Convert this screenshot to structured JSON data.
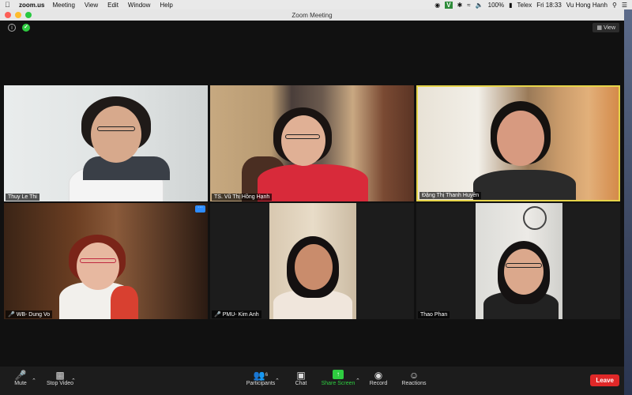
{
  "menubar": {
    "app_name": "zoom.us",
    "items": [
      "Meeting",
      "View",
      "Edit",
      "Window",
      "Help"
    ],
    "battery": "100%",
    "input_source": "Telex",
    "clock": "Fri 18:33",
    "user": "Vu Hong Hanh"
  },
  "window": {
    "title": "Zoom Meeting",
    "view_label": "View"
  },
  "participants": [
    {
      "name": "Thuy Le Thi",
      "muted": false,
      "active": false
    },
    {
      "name": "TS. Vũ Thị Hồng Hạnh",
      "muted": false,
      "active": false
    },
    {
      "name": "Đặng Thị Thanh Huyền",
      "muted": false,
      "active": true
    },
    {
      "name": "WB- Dung Vo",
      "muted": true,
      "active": false
    },
    {
      "name": "PMU- Kim Anh",
      "muted": true,
      "active": false
    },
    {
      "name": "Thao Phan",
      "muted": false,
      "active": false
    }
  ],
  "toolbar": {
    "mute_label": "Mute",
    "stop_video_label": "Stop Video",
    "participants_label": "Participants",
    "participants_count": "6",
    "chat_label": "Chat",
    "share_screen_label": "Share Screen",
    "record_label": "Record",
    "reactions_label": "Reactions",
    "leave_label": "Leave"
  },
  "colors": {
    "active_speaker_border": "#e6d44a",
    "share_green": "#2ecc40",
    "leave_red": "#e02828",
    "zoom_blue": "#2d8cff"
  }
}
